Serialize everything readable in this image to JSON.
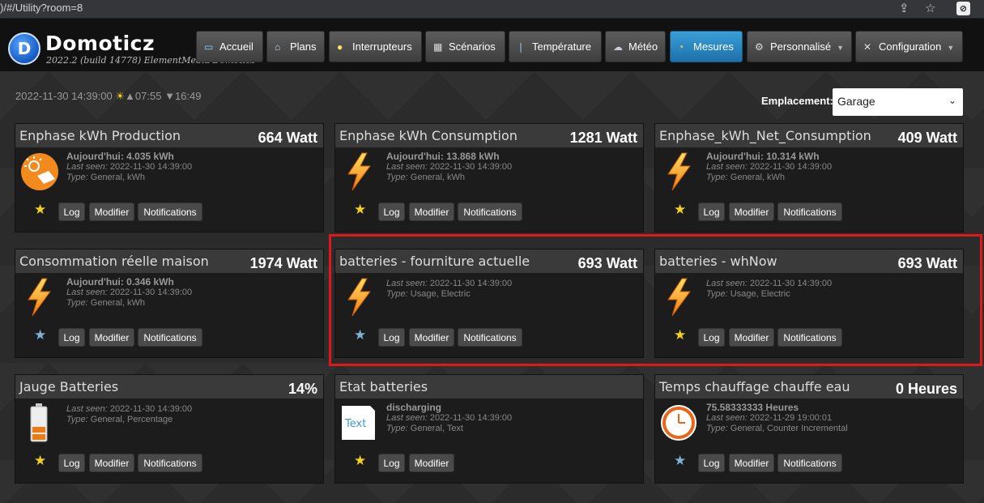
{
  "browser": {
    "url": ")/#/Utility?room=8"
  },
  "header": {
    "brand": "Domoticz",
    "version": "2022.2 (build 14778) ElementMedia Domoticz"
  },
  "nav": [
    {
      "label": "Accueil",
      "icon": "screen-icon",
      "glyph": "▭"
    },
    {
      "label": "Plans",
      "icon": "house-icon",
      "glyph": "⌂"
    },
    {
      "label": "Interrupteurs",
      "icon": "bulb-icon",
      "glyph": "●"
    },
    {
      "label": "Scénarios",
      "icon": "clapper-icon",
      "glyph": "▦"
    },
    {
      "label": "Température",
      "icon": "thermometer-icon",
      "glyph": "❘"
    },
    {
      "label": "Météo",
      "icon": "cloud-icon",
      "glyph": "☁"
    },
    {
      "label": "Mesures",
      "icon": "gauge-icon",
      "glyph": "◔"
    },
    {
      "label": "Personnalisé",
      "icon": "gear-icon",
      "glyph": "⚙"
    },
    {
      "label": "Configuration",
      "icon": "tools-icon",
      "glyph": "✕"
    }
  ],
  "status": {
    "datetime": "2022-11-30 14:39:00",
    "sunrise": "07:55",
    "sunset": "16:49"
  },
  "location": {
    "label": "Emplacement:",
    "selected": "Garage"
  },
  "buttons": {
    "log": "Log",
    "modify": "Modifier",
    "notifications": "Notifications"
  },
  "cards": [
    {
      "name": "Enphase kWh Production",
      "value": "664 Watt",
      "line1": "Aujourd'hui: 4.035 kWh",
      "lastseen_label": "Last seen:",
      "lastseen": "2022-11-30 14:39:00",
      "type_label": "Type:",
      "type": "General, kWh",
      "icon": "solar-panel-icon",
      "favorite": true
    },
    {
      "name": "Enphase kWh Consumption",
      "value": "1281 Watt",
      "line1": "Aujourd'hui: 13.868 kWh",
      "lastseen_label": "Last seen:",
      "lastseen": "2022-11-30 14:39:00",
      "type_label": "Type:",
      "type": "General, kWh",
      "icon": "lightning-icon",
      "favorite": true
    },
    {
      "name": "Enphase_kWh_Net_Consumption",
      "value": "409 Watt",
      "line1": "Aujourd'hui: 10.314 kWh",
      "lastseen_label": "Last seen:",
      "lastseen": "2022-11-30 14:39:00",
      "type_label": "Type:",
      "type": "General, kWh",
      "icon": "lightning-icon",
      "favorite": true
    },
    {
      "name": "Consommation réelle maison",
      "value": "1974 Watt",
      "line1": "Aujourd'hui: 0.346 kWh",
      "lastseen_label": "Last seen:",
      "lastseen": "2022-11-30 14:39:00",
      "type_label": "Type:",
      "type": "General, kWh",
      "icon": "lightning-icon",
      "favorite": false
    },
    {
      "name": "batteries - fourniture actuelle",
      "value": "693 Watt",
      "line1": "",
      "lastseen_label": "Last seen:",
      "lastseen": "2022-11-30 14:39:00",
      "type_label": "Type:",
      "type": "Usage, Electric",
      "icon": "lightning-icon",
      "favorite": false
    },
    {
      "name": "batteries - whNow",
      "value": "693 Watt",
      "line1": "",
      "lastseen_label": "Last seen:",
      "lastseen": "2022-11-30 14:39:00",
      "type_label": "Type:",
      "type": "Usage, Electric",
      "icon": "lightning-icon",
      "favorite": true
    },
    {
      "name": "Jauge Batteries",
      "value": "14%",
      "line1": "",
      "lastseen_label": "Last seen:",
      "lastseen": "2022-11-30 14:39:00",
      "type_label": "Type:",
      "type": "General, Percentage",
      "icon": "battery-icon",
      "favorite": true
    },
    {
      "name": "Etat batteries",
      "value": "",
      "line1": "discharging",
      "lastseen_label": "Last seen:",
      "lastseen": "2022-11-30 14:39:00",
      "type_label": "Type:",
      "type": "General, Text",
      "icon": "text-document-icon",
      "icon_text": "Text",
      "favorite": true
    },
    {
      "name": "Temps chauffage chauffe eau",
      "value": "0 Heures",
      "line1": "75.58333333 Heures",
      "lastseen_label": "Last seen:",
      "lastseen": "2022-11-29 19:00:01",
      "type_label": "Type:",
      "type": "General, Counter Incremental",
      "icon": "clock-icon",
      "favorite": false
    }
  ],
  "colors": {
    "highlight": "#e01818",
    "accent": "#2a88c4",
    "star": "#f2d21f"
  }
}
